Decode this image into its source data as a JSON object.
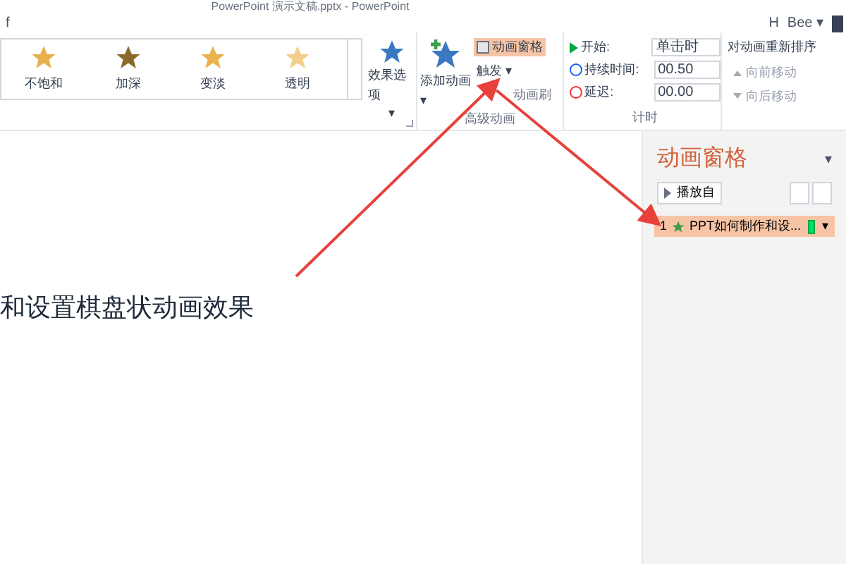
{
  "window": {
    "title": "PowerPoint 演示文稿.pptx - PowerPoint"
  },
  "menu_fragment": "f",
  "user": {
    "initial": "H",
    "name": "Bee",
    "caret": "▾"
  },
  "ribbon": {
    "effects_gallery": [
      {
        "label": "不饱和",
        "color": "#e8b04a"
      },
      {
        "label": "加深",
        "color": "#8a6a2a"
      },
      {
        "label": "变淡",
        "color": "#eab24e"
      },
      {
        "label": "透明",
        "color": "#f2cf8c"
      }
    ],
    "effect_options": {
      "label": "效果选项",
      "caret": "▾"
    },
    "advanced": {
      "group_label": "高级动画",
      "add_animation": {
        "label": "添加动画",
        "caret": "▾"
      },
      "items": [
        {
          "label": "动画窗格",
          "selected": true,
          "disabled": false
        },
        {
          "label": "触发 ▾",
          "selected": false,
          "disabled": false
        },
        {
          "label": "动画刷",
          "selected": false,
          "disabled": true
        }
      ]
    },
    "timing": {
      "group_label": "计时",
      "start": {
        "label": "开始:",
        "value": "单击时"
      },
      "duration": {
        "label": "持续时间:",
        "value": "00.50"
      },
      "delay": {
        "label": "延迟:",
        "value": "00.00"
      }
    },
    "reorder": {
      "title": "对动画重新排序",
      "items": [
        {
          "label": "向前移动",
          "kind": "up",
          "disabled": true
        },
        {
          "label": "向后移动",
          "kind": "down",
          "disabled": true
        }
      ]
    }
  },
  "slide": {
    "text": "和设置棋盘状动画效果"
  },
  "animation_pane": {
    "title": "动画窗格",
    "menu_caret": "▾",
    "play_button": "播放自",
    "items": [
      {
        "number": "1",
        "label": "PPT如何制作和设...",
        "selected": true,
        "caret": "▾"
      }
    ]
  }
}
